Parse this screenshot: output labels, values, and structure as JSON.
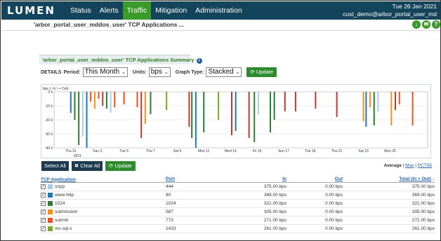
{
  "brand": "LUMEN",
  "nav": [
    "Status",
    "Alerts",
    "Traffic",
    "Mitigation",
    "Administration"
  ],
  "user": {
    "date": "Tue 26 Jan 2021",
    "account": "cust_demo@arbor_portal_user_md"
  },
  "page_title": "'arbor_portal_user_mddos_user' TCP Applications ...",
  "panel_title": "'arbor_portal_user_mddos_user' TCP Applications Summary",
  "controls": {
    "details": "DETAILS",
    "period_label": "Period:",
    "period": "This Month",
    "units_label": "Units:",
    "units": "bps",
    "graph_label": "Graph Type:",
    "graph": "Stacked",
    "update": "Update"
  },
  "buttons": {
    "select_all": "Select All",
    "clear_all": "Clear All",
    "update": "Update"
  },
  "avg_links": {
    "average": "Average",
    "max": "Max",
    "pct95": "PCT95"
  },
  "table": {
    "headers": {
      "app": "TCP Application",
      "port": "Port",
      "in": "In",
      "out": "Out",
      "total": "Total (In + Out)"
    },
    "rows": [
      {
        "name": "snpp",
        "port": "444",
        "in": "375.00 bps",
        "out": "0.00 bps",
        "total": "375.00 bps",
        "color": "#a9cfe8"
      },
      {
        "name": "www-http",
        "port": "80",
        "in": "369.00 bps",
        "out": "0.00 bps",
        "total": "369.00 bps",
        "color": "#1f77b4"
      },
      {
        "name": "1024",
        "port": "1024",
        "in": "321.00 bps",
        "out": "0.00 bps",
        "total": "321.00 bps",
        "color": "#2e7d32"
      },
      {
        "name": "submission",
        "port": "587",
        "in": "305.00 bps",
        "out": "0.00 bps",
        "total": "305.00 bps",
        "color": "#f0911a"
      },
      {
        "name": "submit",
        "port": "773",
        "in": "271.00 bps",
        "out": "0.00 bps",
        "total": "271.00 bps",
        "color": "#e8521e"
      },
      {
        "name": "ms-sql-s",
        "port": "1433",
        "in": "261.00 bps",
        "out": "0.00 bps",
        "total": "261.00 bps",
        "color": "#7aa82e"
      }
    ]
  },
  "chart_data": {
    "type": "bar",
    "ylabel": "bps (- In / + Out)",
    "ylim": [
      -40000,
      0
    ],
    "yticks": [
      "0 k",
      "-10 k",
      "-20 k",
      "-30 k",
      "-40 k"
    ],
    "xticks": [
      "Thu 31",
      "Sun 3",
      "Tue 5",
      "Thu 7",
      "Sat 9",
      "Mon 11",
      "Wed 13",
      "Fri 15",
      "Sun 17",
      "Tue 19",
      "Thu 21",
      "Sat 23",
      "Mon 25"
    ],
    "xsub": "2021",
    "bars": [
      {
        "d": 0.2,
        "v": -15000,
        "c": "#1f77b4"
      },
      {
        "d": 0.5,
        "v": -20000,
        "c": "#2e7d32"
      },
      {
        "d": 0.8,
        "v": -38000,
        "c": "#2e7d32"
      },
      {
        "d": 1.1,
        "v": -32000,
        "c": "#a9cfe8"
      },
      {
        "d": 1.4,
        "v": -40000,
        "c": "#1f77b4"
      },
      {
        "d": 1.7,
        "v": -7000,
        "c": "#e8521e"
      },
      {
        "d": 2.0,
        "v": -12000,
        "c": "#f0911a"
      },
      {
        "d": 2.3,
        "v": -5000,
        "c": "#e8521e"
      },
      {
        "d": 2.6,
        "v": -10000,
        "c": "#c0392b"
      },
      {
        "d": 2.9,
        "v": -12000,
        "c": "#2e7d32"
      },
      {
        "d": 3.2,
        "v": -15000,
        "c": "#a9cfe8"
      },
      {
        "d": 3.5,
        "v": -11000,
        "c": "#e8521e"
      },
      {
        "d": 4.2,
        "v": -9000,
        "c": "#e8521e"
      },
      {
        "d": 5.2,
        "v": -11000,
        "c": "#e8521e"
      },
      {
        "d": 5.5,
        "v": -33000,
        "c": "#c0392b"
      },
      {
        "d": 5.8,
        "v": -23000,
        "c": "#f0911a"
      },
      {
        "d": 6.2,
        "v": -16000,
        "c": "#2e7d32"
      },
      {
        "d": 7.4,
        "v": -13000,
        "c": "#7aa82e"
      },
      {
        "d": 9.1,
        "v": -25000,
        "c": "#c0392b"
      },
      {
        "d": 9.3,
        "v": -33000,
        "c": "#2e7d32"
      },
      {
        "d": 9.6,
        "v": -55000,
        "c": "#1f77b4"
      },
      {
        "d": 10.2,
        "v": -29000,
        "c": "#2e7d32"
      },
      {
        "d": 11.3,
        "v": -20000,
        "c": "#7aa82e"
      },
      {
        "d": 12.3,
        "v": -31000,
        "c": "#c0392b"
      },
      {
        "d": 12.6,
        "v": -28000,
        "c": "#1f77b4"
      },
      {
        "d": 13.6,
        "v": -33000,
        "c": "#c0392b"
      },
      {
        "d": 14.0,
        "v": -36000,
        "c": "#2e7d32"
      },
      {
        "d": 14.3,
        "v": -16000,
        "c": "#a9cfe8"
      },
      {
        "d": 15.2,
        "v": -29000,
        "c": "#2e7d32"
      },
      {
        "d": 15.5,
        "v": -20000,
        "c": "#2e7d32"
      },
      {
        "d": 16.3,
        "v": -14000,
        "c": "#c0392b"
      },
      {
        "d": 17.1,
        "v": -14000,
        "c": "#c0392b"
      },
      {
        "d": 18.6,
        "v": -12000,
        "c": "#c0392b"
      },
      {
        "d": 20.2,
        "v": -18000,
        "c": "#c0392b"
      },
      {
        "d": 22.2,
        "v": -21000,
        "c": "#f0911a"
      },
      {
        "d": 22.4,
        "v": -25000,
        "c": "#1f77b4"
      },
      {
        "d": 22.7,
        "v": -11000,
        "c": "#f0911a"
      },
      {
        "d": 23.0,
        "v": -24000,
        "c": "#2e7d32"
      },
      {
        "d": 23.3,
        "v": -14000,
        "c": "#a9cfe8"
      },
      {
        "d": 24.3,
        "v": -24000,
        "c": "#f0911a"
      },
      {
        "d": 24.6,
        "v": -13000,
        "c": "#c0392b"
      },
      {
        "d": 24.9,
        "v": -9000,
        "c": "#e8521e"
      },
      {
        "d": 25.9,
        "v": -24000,
        "c": "#e8521e"
      }
    ]
  }
}
